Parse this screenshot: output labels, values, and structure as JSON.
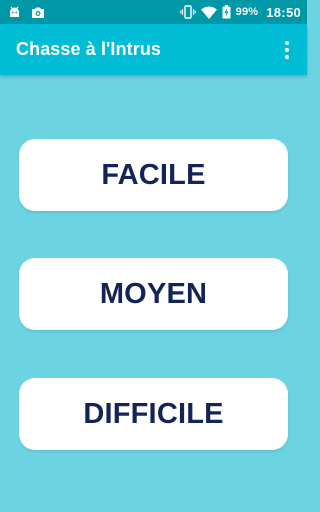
{
  "status_bar": {
    "battery_percent": "99%",
    "time": "18:50",
    "icons": [
      "android-debug-icon",
      "notification-photo-icon",
      "vibrate-icon",
      "wifi-icon",
      "battery-icon"
    ],
    "background_color": "#0097a7"
  },
  "app_bar": {
    "title": "Chasse à l'Intrus",
    "menu_icon": "more-vert-icon",
    "background_color": "#00bcd4"
  },
  "main": {
    "background_color": "#6bd3e1",
    "buttons": [
      {
        "label": "FACILE"
      },
      {
        "label": "MOYEN"
      },
      {
        "label": "DIFFICILE"
      }
    ],
    "button_text_color": "#142457"
  }
}
